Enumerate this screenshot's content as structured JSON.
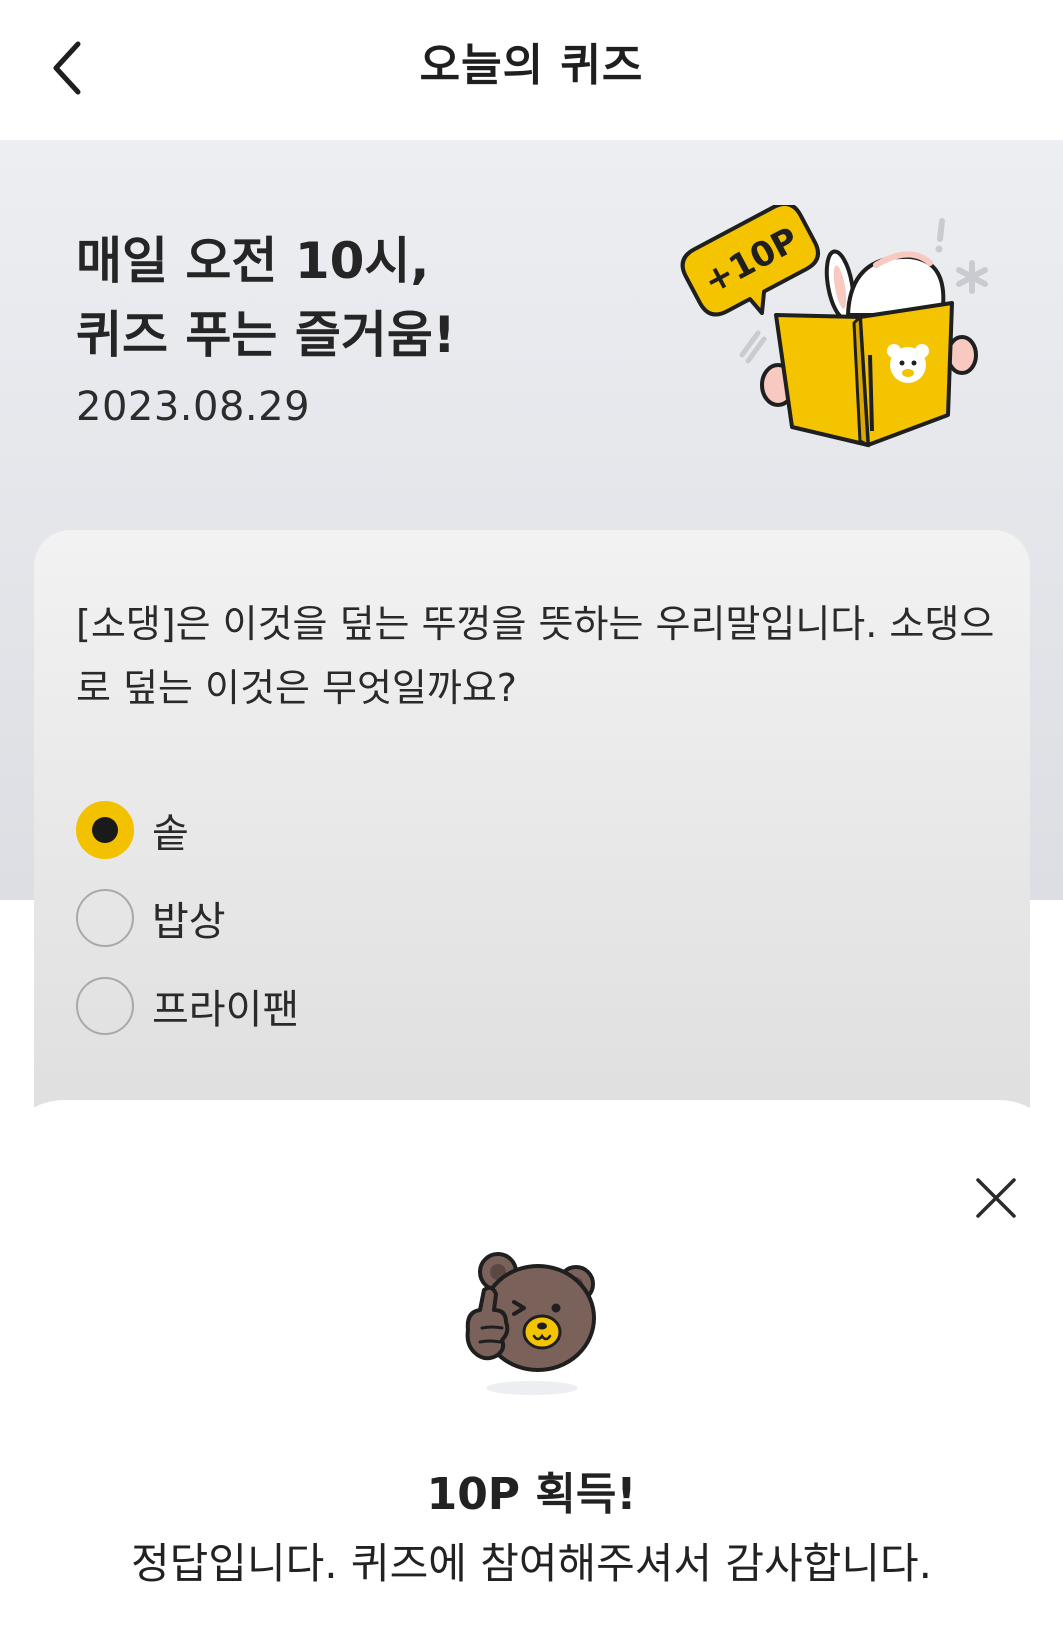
{
  "header": {
    "title": "오늘의 퀴즈"
  },
  "hero": {
    "title_line1": "매일 오전 10시,",
    "title_line2": "퀴즈 푸는 즐거움!",
    "date": "2023.08.29",
    "badge": "+10P"
  },
  "quiz": {
    "question": "[소댕]은 이것을 덮는 뚜껑을 뜻하는 우리말입니다. 소댕으로 덮는 이것은 무엇일까요?",
    "options": [
      {
        "label": "솥",
        "selected": true
      },
      {
        "label": "밥상",
        "selected": false
      },
      {
        "label": "프라이팬",
        "selected": false
      }
    ]
  },
  "result": {
    "title": "10P 획득!",
    "message": "정답입니다. 퀴즈에 참여해주셔서 감사합니다."
  },
  "colors": {
    "accent": "#f2c200",
    "hero_bg": "#e6e8ec",
    "bear_brown": "#7a625a"
  }
}
